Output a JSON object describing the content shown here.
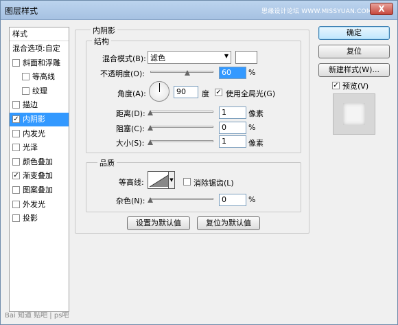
{
  "window": {
    "title": "图层样式",
    "watermark": "思缘设计论坛 WWW.MISSYUAN.COM",
    "close_glyph": "X"
  },
  "sidebar": {
    "header": "样式",
    "items": [
      {
        "label": "混合选项:自定",
        "has_checkbox": false,
        "checked": false,
        "selected": false
      },
      {
        "label": "斜面和浮雕",
        "has_checkbox": true,
        "checked": false,
        "selected": false
      },
      {
        "label": "等高线",
        "has_checkbox": true,
        "checked": false,
        "selected": false
      },
      {
        "label": "纹理",
        "has_checkbox": true,
        "checked": false,
        "selected": false
      },
      {
        "label": "描边",
        "has_checkbox": true,
        "checked": false,
        "selected": false
      },
      {
        "label": "内阴影",
        "has_checkbox": true,
        "checked": true,
        "selected": true
      },
      {
        "label": "内发光",
        "has_checkbox": true,
        "checked": false,
        "selected": false
      },
      {
        "label": "光泽",
        "has_checkbox": true,
        "checked": false,
        "selected": false
      },
      {
        "label": "颜色叠加",
        "has_checkbox": true,
        "checked": false,
        "selected": false
      },
      {
        "label": "渐变叠加",
        "has_checkbox": true,
        "checked": true,
        "selected": false
      },
      {
        "label": "图案叠加",
        "has_checkbox": true,
        "checked": false,
        "selected": false
      },
      {
        "label": "外发光",
        "has_checkbox": true,
        "checked": false,
        "selected": false
      },
      {
        "label": "投影",
        "has_checkbox": true,
        "checked": false,
        "selected": false
      }
    ]
  },
  "panel": {
    "title": "内阴影",
    "structure": {
      "legend": "结构",
      "blend_mode_label": "混合模式(B):",
      "blend_mode_value": "滤色",
      "opacity_label": "不透明度(O):",
      "opacity_value": "60",
      "opacity_unit": "%",
      "opacity_fraction": 0.6,
      "angle_label": "角度(A):",
      "angle_value": "90",
      "angle_unit": "度",
      "global_light_label": "使用全局光(G)",
      "global_light_checked": true,
      "distance_label": "距离(D):",
      "distance_value": "1",
      "distance_unit": "像素",
      "choke_label": "阻塞(C):",
      "choke_value": "0",
      "choke_unit": "%",
      "size_label": "大小(S):",
      "size_value": "1",
      "size_unit": "像素"
    },
    "quality": {
      "legend": "品质",
      "contour_label": "等高线:",
      "antialias_label": "消除锯齿(L)",
      "antialias_checked": false,
      "noise_label": "杂色(N):",
      "noise_value": "0",
      "noise_unit": "%"
    },
    "make_default_label": "设置为默认值",
    "reset_default_label": "复位为默认值"
  },
  "buttons": {
    "ok": "确定",
    "reset": "复位",
    "new_style": "新建样式(W)...",
    "preview_label": "预览(V)",
    "preview_checked": true
  },
  "footer": {
    "baidu": "Bai 知道 贴吧 | ps吧"
  },
  "colors": {
    "selection": "#3399ff",
    "shadow_color_swatch": "#ffffff"
  }
}
